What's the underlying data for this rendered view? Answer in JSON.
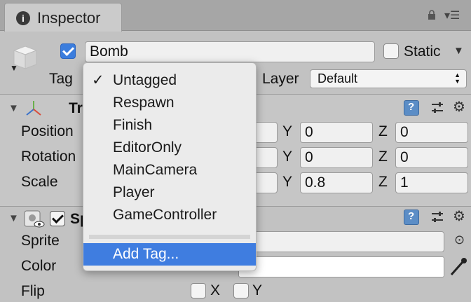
{
  "tab": {
    "title": "Inspector",
    "info_icon": "i"
  },
  "header": {
    "object_name": "Bomb",
    "static_label": "Static",
    "tag_label": "Tag",
    "layer_label": "Layer",
    "layer_value": "Default"
  },
  "transform": {
    "title_partial": "Tr",
    "rows": [
      {
        "label": "Position",
        "y": "0",
        "z": "0"
      },
      {
        "label": "Rotation",
        "y": "0",
        "z": "0"
      },
      {
        "label": "Scale",
        "y": "0.8",
        "z": "1"
      }
    ],
    "axis_y": "Y",
    "axis_z": "Z"
  },
  "sprite_renderer": {
    "title_partial": "Sp",
    "sprite_label": "Sprite",
    "color_label": "Color",
    "flip_label": "Flip",
    "flip_x": "X",
    "flip_y": "Y"
  },
  "tag_menu": {
    "checkmark": "✓",
    "items": [
      "Untagged",
      "Respawn",
      "Finish",
      "EditorOnly",
      "MainCamera",
      "Player",
      "GameController"
    ],
    "selected": "Untagged",
    "add_tag": "Add Tag..."
  },
  "colors": {
    "highlight": "#3f7de0",
    "checkbox_blue": "#3b7ddd"
  }
}
